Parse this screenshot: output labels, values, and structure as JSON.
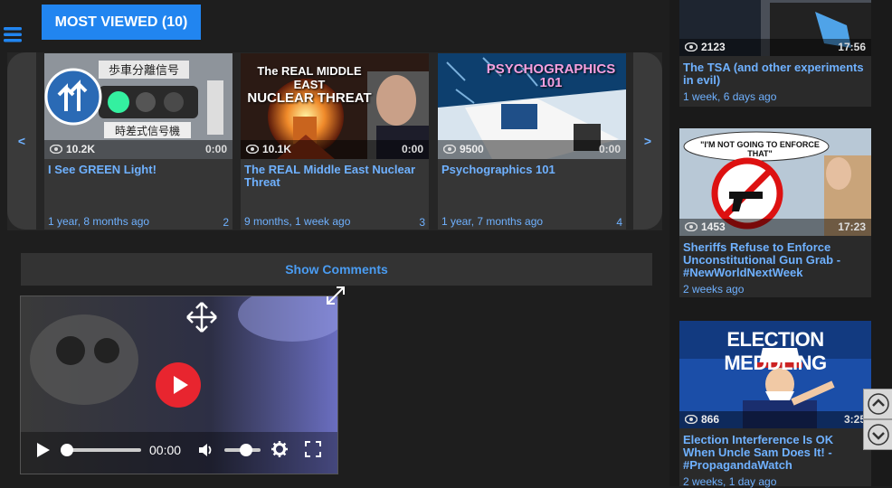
{
  "header": {
    "most_viewed_label": "MOST VIEWED (10)"
  },
  "carousel": {
    "prev_label": "<",
    "next_label": ">",
    "cards": [
      {
        "title": "I See GREEN Light!",
        "views": "10.2K",
        "duration": "0:00",
        "date": "1 year, 8 months ago",
        "rank": "2"
      },
      {
        "title": "The REAL Middle East Nuclear Threat",
        "views": "10.1K",
        "duration": "0:00",
        "date": "9 months, 1 week ago",
        "rank": "3",
        "thumb_text": [
          "The REAL MIDDLE EAST",
          "NUCLEAR THREAT"
        ]
      },
      {
        "title": "Psychographics 101",
        "views": "9500",
        "duration": "0:00",
        "date": "1 year, 7 months ago",
        "rank": "4",
        "thumb_text": [
          "PSYCHOGRAPHICS",
          "101"
        ]
      }
    ]
  },
  "comments": {
    "show_label": "Show Comments"
  },
  "player": {
    "time": "00:00",
    "volume_pct": 60,
    "progress_pct": 0
  },
  "sidebar": {
    "items": [
      {
        "title": "The TSA (and other experiments in evil)",
        "views": "2123",
        "duration": "17:56",
        "date": "1 week, 6 days ago"
      },
      {
        "title": "Sheriffs Refuse to Enforce Unconstitutional Gun Grab - #NewWorldNextWeek",
        "views": "1453",
        "duration": "17:23",
        "date": "2 weeks ago",
        "thumb_text": "\"I'M NOT GOING TO ENFORCE THAT\""
      },
      {
        "title": "Election Interference Is OK When Uncle Sam Does It! - #PropagandaWatch",
        "views": "866",
        "duration": "3:25",
        "date": "2 weeks, 1 day ago",
        "thumb_text": "ELECTION MEDDLING"
      }
    ]
  },
  "colors": {
    "accent": "#2185f0",
    "link": "#6fb1ff",
    "play": "#e8252f"
  }
}
